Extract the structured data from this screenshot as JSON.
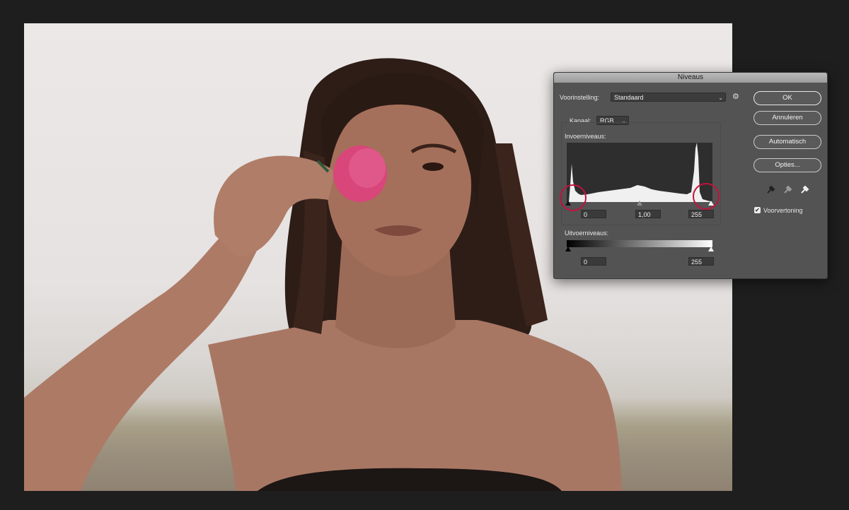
{
  "dialog": {
    "title": "Niveaus",
    "preset_label": "Voorinstelling:",
    "preset_value": "Standaard",
    "channel_label": "Kanaal:",
    "channel_value": "RGB",
    "input_levels_label": "Invoerniveaus:",
    "input_black": "0",
    "input_gamma": "1,00",
    "input_white": "255",
    "output_levels_label": "Uitvoerniveaus:",
    "output_black": "0",
    "output_white": "255",
    "buttons": {
      "ok": "OK",
      "cancel": "Annuleren",
      "auto": "Automatisch",
      "options": "Opties..."
    },
    "preview_label": "Voorvertoning",
    "preview_checked": true,
    "chevron": "⌄",
    "gear": "⚙"
  },
  "colors": {
    "dialog_bg": "#535353",
    "highlight_circle": "#c3123c"
  },
  "icons": {
    "eyedroppers": [
      "black-eyedropper-icon",
      "gray-eyedropper-icon",
      "white-eyedropper-icon"
    ]
  }
}
